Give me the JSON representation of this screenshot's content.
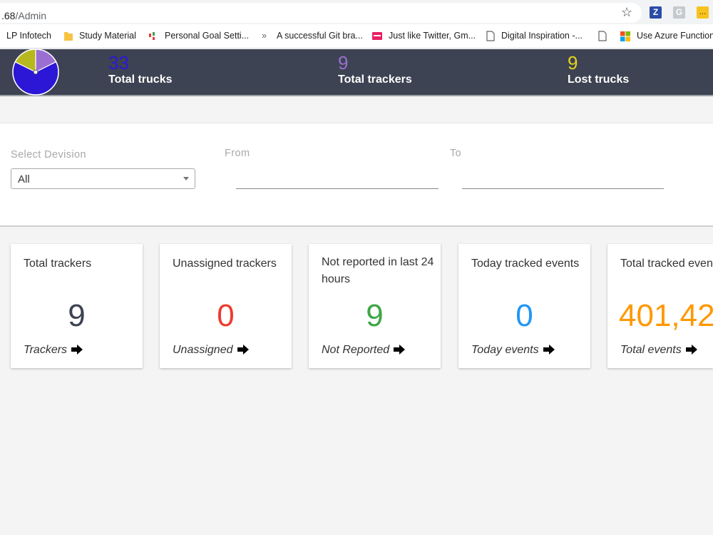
{
  "browser": {
    "url_visible": ".68",
    "url_path": "/Admin",
    "extensions": [
      "Z",
      "G",
      "…"
    ],
    "bookmarks": [
      {
        "label": "LP Infotech",
        "icon": "none"
      },
      {
        "label": "Study Material",
        "icon": "folder-icon"
      },
      {
        "label": "Personal Goal Setti...",
        "icon": "app-icon"
      },
      {
        "label": "»",
        "icon": "none"
      },
      {
        "label": "A successful Git bra...",
        "icon": "none"
      },
      {
        "label": "Just like Twitter, Gm...",
        "icon": "site-icon"
      },
      {
        "label": "Digital Inspiration -...",
        "icon": "page-icon"
      },
      {
        "label": "Use Azure Function...",
        "icon": "windows-icon"
      }
    ]
  },
  "stats": {
    "total_trucks": {
      "value": "33",
      "label": "Total trucks",
      "color": "#2d17d6"
    },
    "total_trackers": {
      "value": "9",
      "label": "Total trackers",
      "color": "#9b6fd1"
    },
    "lost_trucks": {
      "value": "9",
      "label": "Lost trucks",
      "color": "#e7d41c"
    }
  },
  "pie_data": {
    "type": "pie",
    "values": [
      33,
      9,
      9
    ],
    "colors": [
      "#2d17d6",
      "#9b6fd1",
      "#b6b81e"
    ]
  },
  "filters": {
    "division_label": "Select Devision",
    "division_value": "All",
    "from_label": "From",
    "to_label": "To"
  },
  "cards": [
    {
      "title": "Total trackers",
      "value": "9",
      "color": "#3d4352",
      "link": "Trackers"
    },
    {
      "title": "Unassigned trackers",
      "value": "0",
      "color": "#ee3b2e",
      "link": "Unassigned"
    },
    {
      "title": "Not reported in last 24 hours",
      "value": "9",
      "color": "#3fa645",
      "link": "Not Reported"
    },
    {
      "title": "Today tracked events",
      "value": "0",
      "color": "#2196f3",
      "link": "Today events"
    },
    {
      "title": "Total tracked events",
      "value": "401,42",
      "color": "#ff9800",
      "link": "Total events"
    }
  ]
}
